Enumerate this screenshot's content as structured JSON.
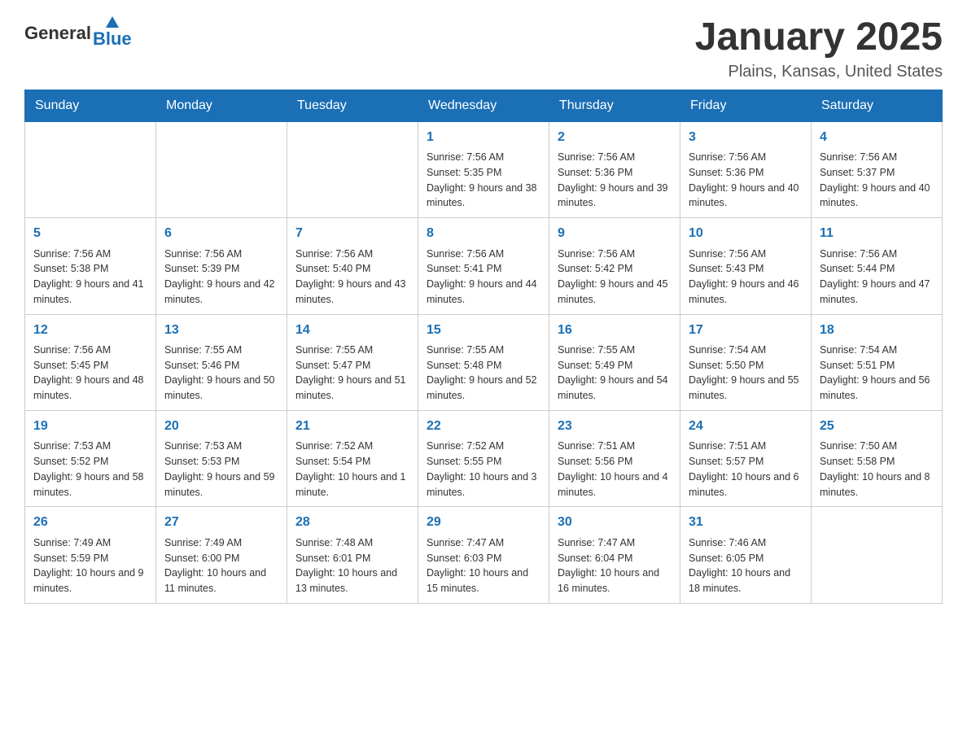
{
  "header": {
    "logo": {
      "general": "General",
      "blue": "Blue"
    },
    "title": "January 2025",
    "location": "Plains, Kansas, United States"
  },
  "weekdays": [
    "Sunday",
    "Monday",
    "Tuesday",
    "Wednesday",
    "Thursday",
    "Friday",
    "Saturday"
  ],
  "weeks": [
    [
      {
        "day": "",
        "info": ""
      },
      {
        "day": "",
        "info": ""
      },
      {
        "day": "",
        "info": ""
      },
      {
        "day": "1",
        "info": "Sunrise: 7:56 AM\nSunset: 5:35 PM\nDaylight: 9 hours and 38 minutes."
      },
      {
        "day": "2",
        "info": "Sunrise: 7:56 AM\nSunset: 5:36 PM\nDaylight: 9 hours and 39 minutes."
      },
      {
        "day": "3",
        "info": "Sunrise: 7:56 AM\nSunset: 5:36 PM\nDaylight: 9 hours and 40 minutes."
      },
      {
        "day": "4",
        "info": "Sunrise: 7:56 AM\nSunset: 5:37 PM\nDaylight: 9 hours and 40 minutes."
      }
    ],
    [
      {
        "day": "5",
        "info": "Sunrise: 7:56 AM\nSunset: 5:38 PM\nDaylight: 9 hours and 41 minutes."
      },
      {
        "day": "6",
        "info": "Sunrise: 7:56 AM\nSunset: 5:39 PM\nDaylight: 9 hours and 42 minutes."
      },
      {
        "day": "7",
        "info": "Sunrise: 7:56 AM\nSunset: 5:40 PM\nDaylight: 9 hours and 43 minutes."
      },
      {
        "day": "8",
        "info": "Sunrise: 7:56 AM\nSunset: 5:41 PM\nDaylight: 9 hours and 44 minutes."
      },
      {
        "day": "9",
        "info": "Sunrise: 7:56 AM\nSunset: 5:42 PM\nDaylight: 9 hours and 45 minutes."
      },
      {
        "day": "10",
        "info": "Sunrise: 7:56 AM\nSunset: 5:43 PM\nDaylight: 9 hours and 46 minutes."
      },
      {
        "day": "11",
        "info": "Sunrise: 7:56 AM\nSunset: 5:44 PM\nDaylight: 9 hours and 47 minutes."
      }
    ],
    [
      {
        "day": "12",
        "info": "Sunrise: 7:56 AM\nSunset: 5:45 PM\nDaylight: 9 hours and 48 minutes."
      },
      {
        "day": "13",
        "info": "Sunrise: 7:55 AM\nSunset: 5:46 PM\nDaylight: 9 hours and 50 minutes."
      },
      {
        "day": "14",
        "info": "Sunrise: 7:55 AM\nSunset: 5:47 PM\nDaylight: 9 hours and 51 minutes."
      },
      {
        "day": "15",
        "info": "Sunrise: 7:55 AM\nSunset: 5:48 PM\nDaylight: 9 hours and 52 minutes."
      },
      {
        "day": "16",
        "info": "Sunrise: 7:55 AM\nSunset: 5:49 PM\nDaylight: 9 hours and 54 minutes."
      },
      {
        "day": "17",
        "info": "Sunrise: 7:54 AM\nSunset: 5:50 PM\nDaylight: 9 hours and 55 minutes."
      },
      {
        "day": "18",
        "info": "Sunrise: 7:54 AM\nSunset: 5:51 PM\nDaylight: 9 hours and 56 minutes."
      }
    ],
    [
      {
        "day": "19",
        "info": "Sunrise: 7:53 AM\nSunset: 5:52 PM\nDaylight: 9 hours and 58 minutes."
      },
      {
        "day": "20",
        "info": "Sunrise: 7:53 AM\nSunset: 5:53 PM\nDaylight: 9 hours and 59 minutes."
      },
      {
        "day": "21",
        "info": "Sunrise: 7:52 AM\nSunset: 5:54 PM\nDaylight: 10 hours and 1 minute."
      },
      {
        "day": "22",
        "info": "Sunrise: 7:52 AM\nSunset: 5:55 PM\nDaylight: 10 hours and 3 minutes."
      },
      {
        "day": "23",
        "info": "Sunrise: 7:51 AM\nSunset: 5:56 PM\nDaylight: 10 hours and 4 minutes."
      },
      {
        "day": "24",
        "info": "Sunrise: 7:51 AM\nSunset: 5:57 PM\nDaylight: 10 hours and 6 minutes."
      },
      {
        "day": "25",
        "info": "Sunrise: 7:50 AM\nSunset: 5:58 PM\nDaylight: 10 hours and 8 minutes."
      }
    ],
    [
      {
        "day": "26",
        "info": "Sunrise: 7:49 AM\nSunset: 5:59 PM\nDaylight: 10 hours and 9 minutes."
      },
      {
        "day": "27",
        "info": "Sunrise: 7:49 AM\nSunset: 6:00 PM\nDaylight: 10 hours and 11 minutes."
      },
      {
        "day": "28",
        "info": "Sunrise: 7:48 AM\nSunset: 6:01 PM\nDaylight: 10 hours and 13 minutes."
      },
      {
        "day": "29",
        "info": "Sunrise: 7:47 AM\nSunset: 6:03 PM\nDaylight: 10 hours and 15 minutes."
      },
      {
        "day": "30",
        "info": "Sunrise: 7:47 AM\nSunset: 6:04 PM\nDaylight: 10 hours and 16 minutes."
      },
      {
        "day": "31",
        "info": "Sunrise: 7:46 AM\nSunset: 6:05 PM\nDaylight: 10 hours and 18 minutes."
      },
      {
        "day": "",
        "info": ""
      }
    ]
  ]
}
